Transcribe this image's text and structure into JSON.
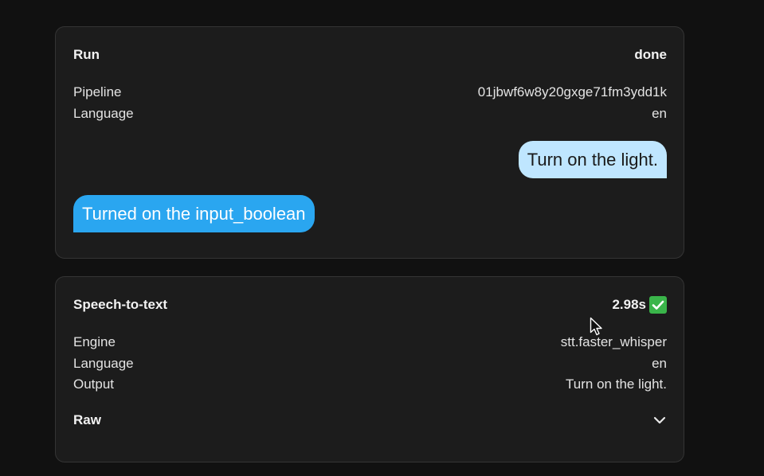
{
  "run": {
    "title": "Run",
    "status": "done",
    "fields": [
      {
        "label": "Pipeline",
        "value": "01jbwf6w8y20gxge71fm3ydd1k"
      },
      {
        "label": "Language",
        "value": "en"
      }
    ],
    "messages": {
      "user": "Turn on the light.",
      "agent": "Turned on the input_boolean"
    }
  },
  "stt": {
    "title": "Speech-to-text",
    "duration": "2.98s",
    "status_icon": "check-mark-icon",
    "fields": [
      {
        "label": "Engine",
        "value": "stt.faster_whisper"
      },
      {
        "label": "Language",
        "value": "en"
      },
      {
        "label": "Output",
        "value": "Turn on the light."
      }
    ],
    "raw_label": "Raw",
    "raw_icon": "chevron-down-icon"
  },
  "colors": {
    "background": "#111111",
    "card": "#1c1c1c",
    "user_bubble": "#bfe6ff",
    "agent_bubble": "#2aa6f0",
    "success": "#3ab54a"
  }
}
